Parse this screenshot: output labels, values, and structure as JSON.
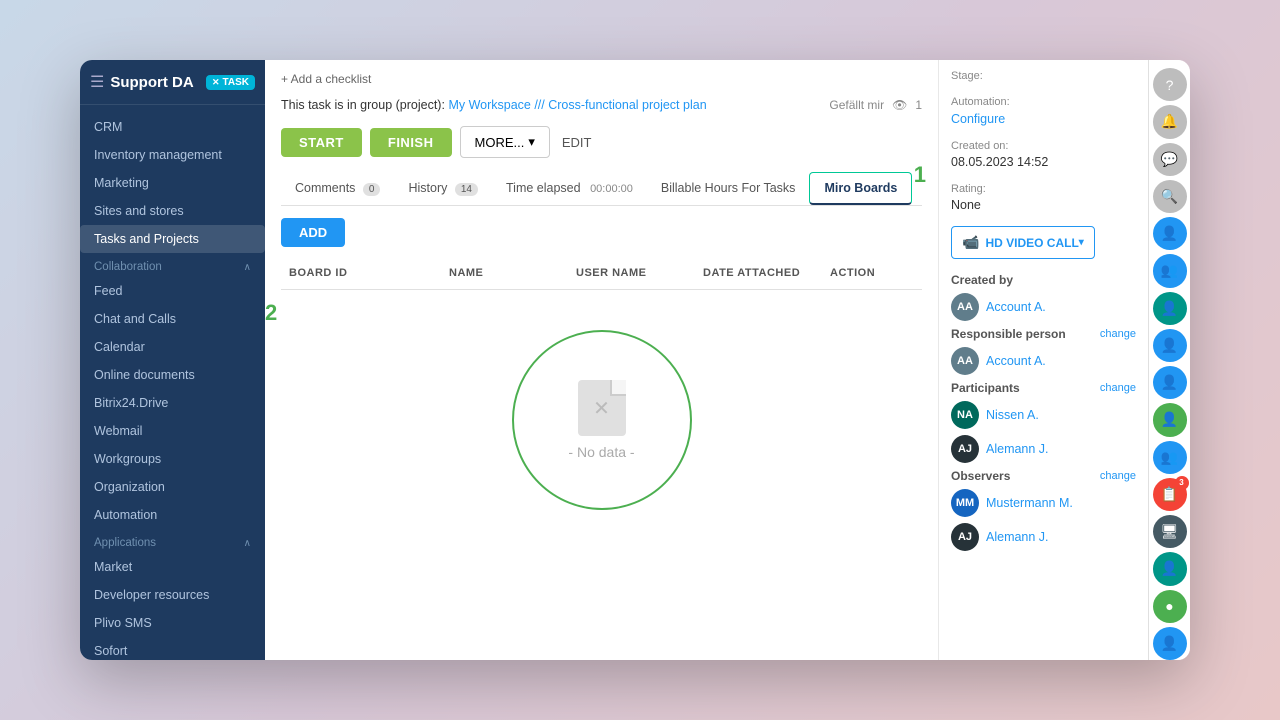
{
  "sidebar": {
    "title": "Support DA",
    "task_badge": "TASK",
    "nav_items": [
      {
        "label": "CRM",
        "active": false,
        "section": null
      },
      {
        "label": "Inventory management",
        "active": false,
        "section": null
      },
      {
        "label": "Marketing",
        "active": false,
        "section": null
      },
      {
        "label": "Sites and stores",
        "active": false,
        "section": null
      },
      {
        "label": "Tasks and Projects",
        "active": true,
        "section": null
      },
      {
        "label": "Collaboration",
        "active": false,
        "section": "section"
      },
      {
        "label": "Feed",
        "active": false,
        "section": null
      },
      {
        "label": "Chat and Calls",
        "active": false,
        "section": null
      },
      {
        "label": "Calendar",
        "active": false,
        "section": null
      },
      {
        "label": "Online documents",
        "active": false,
        "section": null
      },
      {
        "label": "Bitrix24.Drive",
        "active": false,
        "section": null
      },
      {
        "label": "Webmail",
        "active": false,
        "section": null
      },
      {
        "label": "Workgroups",
        "active": false,
        "section": null
      },
      {
        "label": "Organization",
        "active": false,
        "section": null
      },
      {
        "label": "Automation",
        "active": false,
        "section": null
      },
      {
        "label": "Applications",
        "active": false,
        "section": "section"
      },
      {
        "label": "Market",
        "active": false,
        "section": null
      },
      {
        "label": "Developer resources",
        "active": false,
        "section": null
      },
      {
        "label": "Plivo SMS",
        "active": false,
        "section": null
      },
      {
        "label": "Sofort",
        "active": false,
        "section": null
      }
    ]
  },
  "main": {
    "add_checklist": "+ Add a checklist",
    "task_group_prefix": "This task is in group (project):",
    "task_group_link": "My Workspace /// Cross-functional project plan",
    "likes": "Gefällt mir",
    "views": "1",
    "buttons": {
      "start": "START",
      "finish": "FINISH",
      "more": "MORE...",
      "edit": "EDIT"
    },
    "tabs": [
      {
        "label": "Comments",
        "count": "0",
        "active": false
      },
      {
        "label": "History",
        "count": "14",
        "active": false
      },
      {
        "label": "Time elapsed",
        "value": "00:00:00",
        "active": false
      },
      {
        "label": "Billable Hours For Tasks",
        "count": null,
        "active": false
      },
      {
        "label": "Miro Boards",
        "count": null,
        "active": true
      }
    ],
    "table": {
      "add_btn": "ADD",
      "columns": [
        "BOARD ID",
        "NAME",
        "USER NAME",
        "DATE ATTACHED",
        "ACTION"
      ],
      "empty_text": "- No data -"
    }
  },
  "right_panel": {
    "stage_label": "Stage:",
    "automation_label": "Automation:",
    "automation_value": "Configure",
    "created_on_label": "Created on:",
    "created_on_value": "08.05.2023 14:52",
    "rating_label": "Rating:",
    "rating_value": "None",
    "video_call_btn": "HD VIDEO CALL",
    "created_by_label": "Created by",
    "created_by_name": "Account A.",
    "responsible_label": "Responsible person",
    "responsible_name": "Account A.",
    "change_label": "change",
    "participants_label": "Participants",
    "participants": [
      {
        "name": "Nissen A.",
        "initials": "NA",
        "color": "teal"
      },
      {
        "name": "Alemann J.",
        "initials": "AJ",
        "color": "dark"
      }
    ],
    "observers_label": "Observers",
    "observers": [
      {
        "name": "Mustermann M.",
        "initials": "MM",
        "color": "blue"
      },
      {
        "name": "Alemann J.",
        "initials": "AJ",
        "color": "dark"
      }
    ]
  },
  "rail_icons": [
    {
      "name": "help-icon",
      "symbol": "?",
      "color": "gray-icon",
      "badge": null
    },
    {
      "name": "bell-icon",
      "symbol": "🔔",
      "color": "gray-icon",
      "badge": null
    },
    {
      "name": "chat-icon",
      "symbol": "💬",
      "color": "gray-icon",
      "badge": null
    },
    {
      "name": "search-icon",
      "symbol": "🔍",
      "color": "gray-icon",
      "badge": null
    },
    {
      "name": "user1-icon",
      "symbol": "👤",
      "color": "blue-icon",
      "badge": null
    },
    {
      "name": "group-icon",
      "symbol": "👥",
      "color": "blue-icon",
      "badge": null
    },
    {
      "name": "user2-icon",
      "symbol": "👤",
      "color": "teal-icon",
      "badge": null
    },
    {
      "name": "user3-icon",
      "symbol": "👤",
      "color": "blue-icon",
      "badge": null
    },
    {
      "name": "user4-icon",
      "symbol": "👤",
      "color": "blue-icon",
      "badge": null
    },
    {
      "name": "green-user-icon",
      "symbol": "👤",
      "color": "green-icon",
      "badge": null
    },
    {
      "name": "user5-icon",
      "symbol": "👥",
      "color": "blue-icon",
      "badge": null
    },
    {
      "name": "red-icon",
      "symbol": "📋",
      "color": "red-icon",
      "badge": "3"
    },
    {
      "name": "screen-icon",
      "symbol": "🖥",
      "color": "dark-icon",
      "badge": null
    },
    {
      "name": "user6-icon",
      "symbol": "👤",
      "color": "teal-icon",
      "badge": null
    },
    {
      "name": "green-circle-icon",
      "symbol": "●",
      "color": "green-icon",
      "badge": null
    },
    {
      "name": "user7-icon",
      "symbol": "👤",
      "color": "blue-icon",
      "badge": null
    }
  ],
  "number_annotations": {
    "one": "1",
    "two": "2"
  }
}
